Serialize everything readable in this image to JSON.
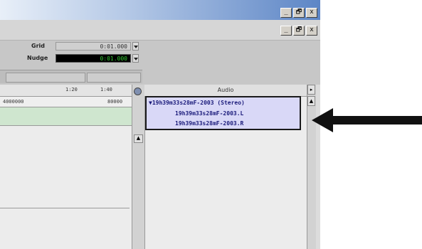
{
  "window": {
    "title_buttons": [
      "_",
      "🗗",
      "x"
    ],
    "doc_buttons": [
      "_",
      "🗗",
      "x"
    ]
  },
  "toolbar": {
    "grid_label": "Grid",
    "grid_value": "0:01.000",
    "nudge_label": "Nudge",
    "nudge_value": "0:01.000"
  },
  "timeline": {
    "ruler_ticks": [
      "1:20",
      "1:40"
    ],
    "code_left": "4000000",
    "code_right": "80000"
  },
  "regions": {
    "header": "Audio",
    "items": [
      "▼19h39m33s28mF-2003 (Stereo)",
      "19h39m33s28mF-2003.L",
      "19h39m33s28mF-2003.R"
    ]
  },
  "colors": {
    "region_highlight": "#d9d8f7",
    "green_track": "#cfe6cf",
    "nudge_bg": "#000000",
    "nudge_text": "#33cc33"
  },
  "icons": {
    "arrow": "arrow-left-icon"
  }
}
